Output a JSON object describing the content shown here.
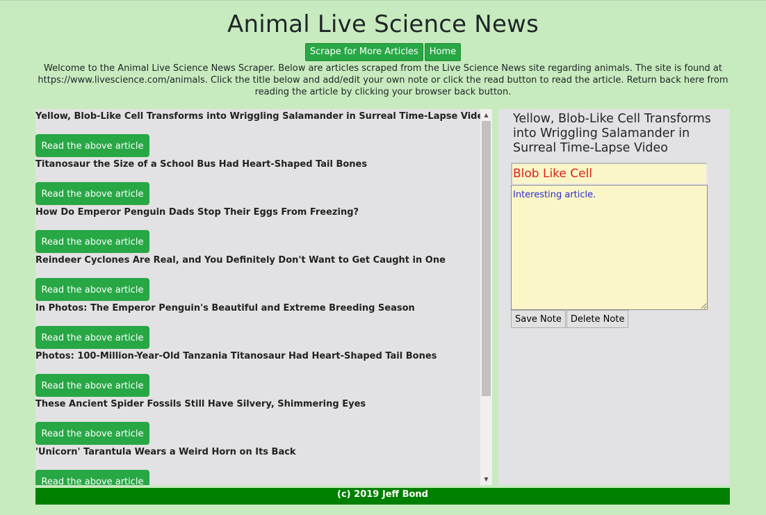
{
  "header": {
    "title": "Animal Live Science News",
    "scrape_label": "Scrape for More Articles",
    "home_label": "Home",
    "intro": "Welcome to the Animal Live Science News Scraper. Below are articles scraped from the Live Science News site regarding animals. The site is found at https://www.livescience.com/animals. Click the title below and add/edit your own note or click the read button to read the article. Return back here from reading the article by clicking your browser back button."
  },
  "articles": [
    {
      "title": "Yellow, Blob-Like Cell Transforms into Wriggling Salamander in Surreal Time-Lapse Video",
      "button": "Read the above article"
    },
    {
      "title": "Titanosaur the Size of a School Bus Had Heart-Shaped Tail Bones",
      "button": "Read the above article"
    },
    {
      "title": "How Do Emperor Penguin Dads Stop Their Eggs From Freezing?",
      "button": "Read the above article"
    },
    {
      "title": "Reindeer Cyclones Are Real, and You Definitely Don't Want to Get Caught in One",
      "button": "Read the above article"
    },
    {
      "title": "In Photos: The Emperor Penguin's Beautiful and Extreme Breeding Season",
      "button": "Read the above article"
    },
    {
      "title": "Photos: 100-Million-Year-Old Tanzania Titanosaur Had Heart-Shaped Tail Bones",
      "button": "Read the above article"
    },
    {
      "title": "These Ancient Spider Fossils Still Have Silvery, Shimmering Eyes",
      "button": "Read the above article"
    },
    {
      "title": "'Unicorn' Tarantula Wears a Weird Horn on Its Back",
      "button": "Read the above article"
    }
  ],
  "note": {
    "heading": "Yellow, Blob-Like Cell Transforms into Wriggling Salamander in Surreal Time-Lapse Video",
    "title_value": "Blob Like Cell",
    "body_value": "Interesting article.",
    "save_label": "Save Note",
    "delete_label": "Delete Note"
  },
  "footer": {
    "text": "(c) 2019 Jeff Bond"
  },
  "colors": {
    "page_background": "#c7ebbe",
    "button_green": "#28a745",
    "footer_green": "#008000",
    "panel_gray": "#e2e1e3",
    "note_yellow": "#fbf6c8",
    "note_title_red": "#e0201b",
    "note_body_blue": "#2b2bd0"
  }
}
